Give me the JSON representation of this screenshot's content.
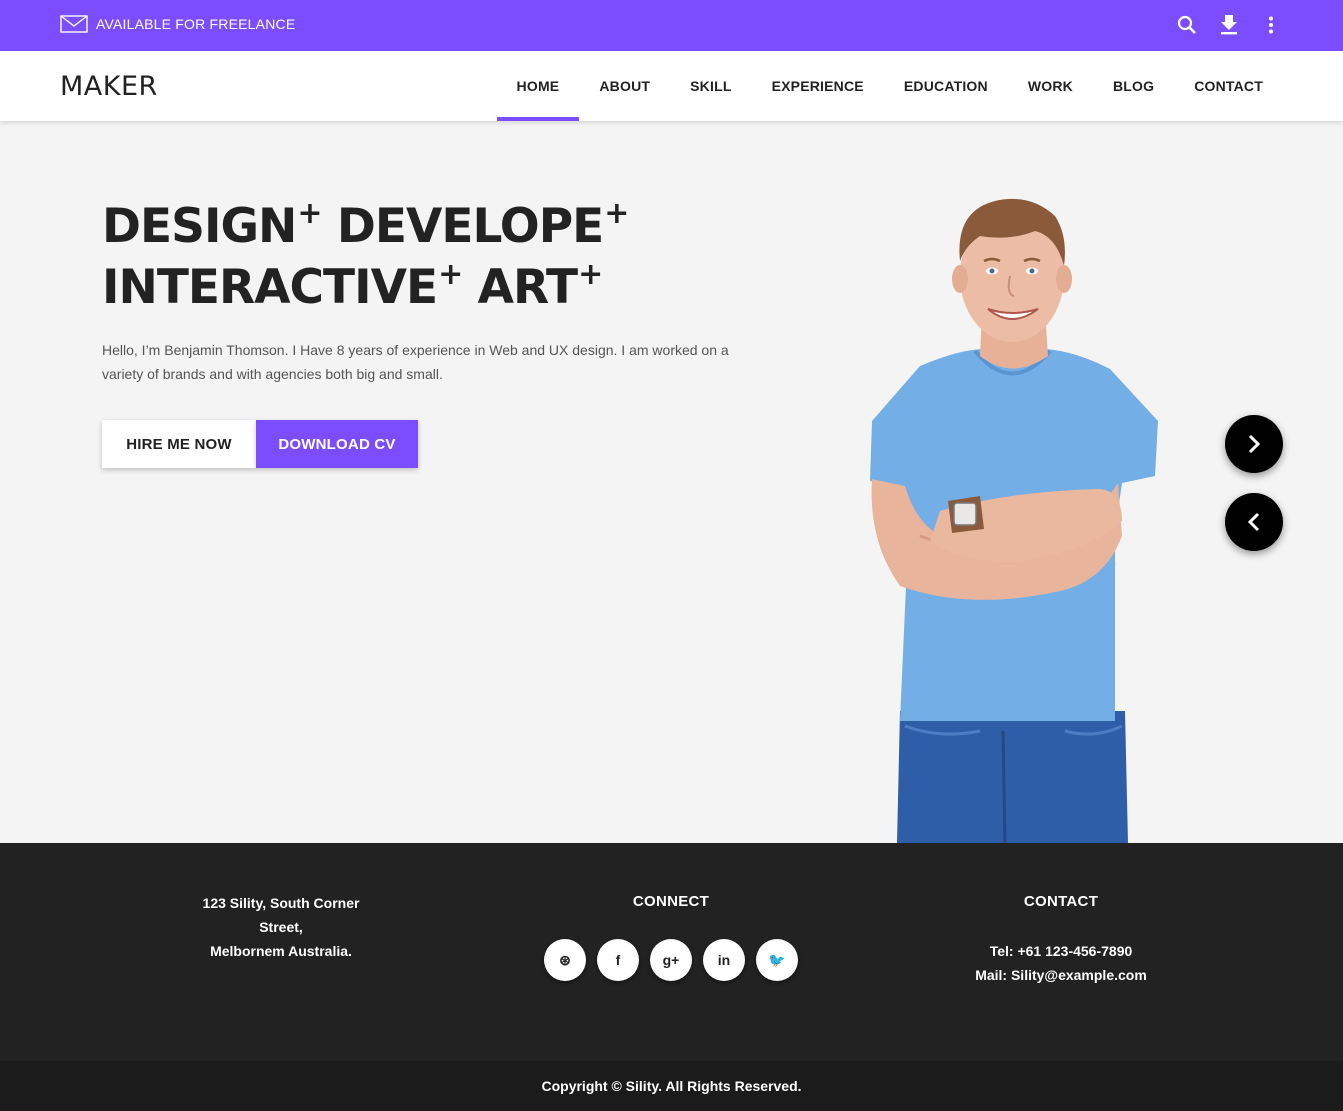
{
  "topbar": {
    "freelance_text": "AVAILABLE FOR FREELANCE",
    "color": "#7c4dff",
    "icons": [
      "mail-icon",
      "search-icon",
      "download-icon",
      "more-vertical-icon"
    ]
  },
  "header": {
    "logo": "MAKER",
    "nav": [
      {
        "label": "HOME",
        "active": true
      },
      {
        "label": "ABOUT"
      },
      {
        "label": "SKILL"
      },
      {
        "label": "EXPERIENCE"
      },
      {
        "label": "EDUCATION"
      },
      {
        "label": "WORK"
      },
      {
        "label": "BLOG"
      },
      {
        "label": "CONTACT"
      }
    ]
  },
  "hero": {
    "headline": {
      "w1": "DESIGN",
      "w2": "DEVELOPE",
      "w3": "INTERACTIVE",
      "w4": "ART",
      "plus": "+"
    },
    "intro": "Hello, I’m Benjamin Thomson. I Have 8 years of experience in Web and UX design. I am worked on a variety of brands and with agencies both big and small.",
    "hire_label": "HIRE ME NOW",
    "cv_label": "DOWNLOAD CV",
    "slider_icons": [
      "chevron-right-icon",
      "chevron-left-icon"
    ]
  },
  "footer": {
    "address_line1": "123 Sility, South Corner Street,",
    "address_line2": "Melbornem Australia.",
    "connect_title": "CONNECT",
    "socials": [
      {
        "name": "dribbble-icon",
        "glyph": "⊛"
      },
      {
        "name": "facebook-icon",
        "glyph": "f"
      },
      {
        "name": "google-plus-icon",
        "glyph": "g+"
      },
      {
        "name": "linkedin-icon",
        "glyph": "in"
      },
      {
        "name": "twitter-icon",
        "glyph": "🐦"
      }
    ],
    "contact_title": "CONTACT",
    "tel": "Tel: +61 123-456-7890",
    "mail": "Mail: Sility@example.com",
    "copyright": "Copyright © Sility. All Rights Reserved."
  }
}
